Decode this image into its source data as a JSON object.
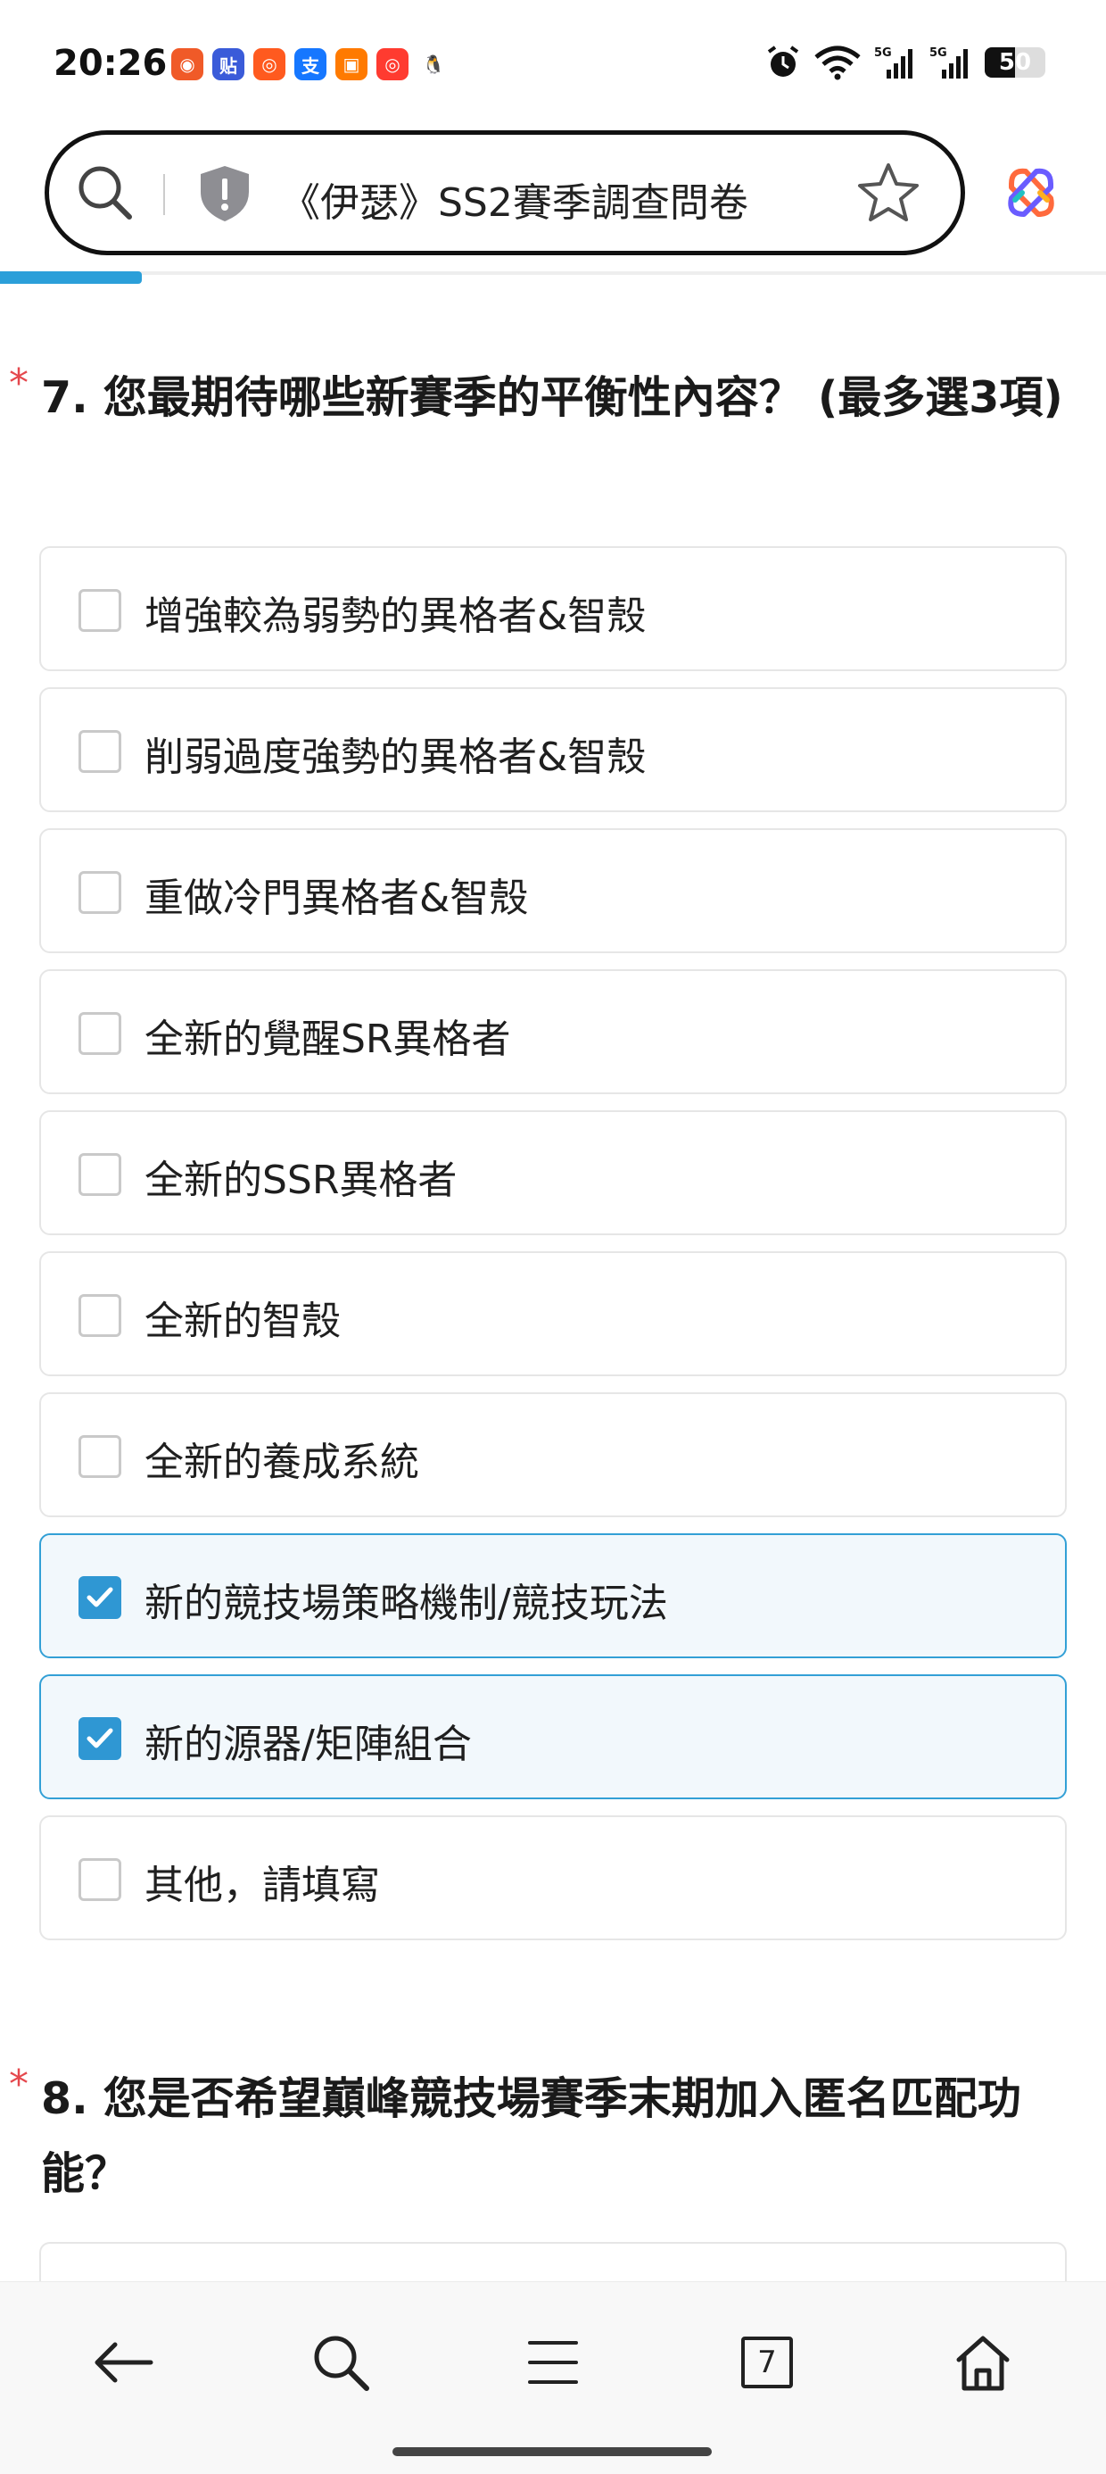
{
  "status_bar": {
    "time": "20:26",
    "battery": "50",
    "notification_icons": [
      {
        "name": "app-a-icon",
        "color": "#f05a28",
        "glyph": "◉"
      },
      {
        "name": "tieba-icon",
        "color": "#3a5bd9",
        "glyph": "贴"
      },
      {
        "name": "app-b-icon",
        "color": "#ff5a1f",
        "glyph": "◎"
      },
      {
        "name": "alipay-icon",
        "color": "#1677ff",
        "glyph": "支"
      },
      {
        "name": "wallet-icon",
        "color": "#ff7a00",
        "glyph": "▣"
      },
      {
        "name": "app-c-icon",
        "color": "#ff3b30",
        "glyph": "◎"
      },
      {
        "name": "qq-icon",
        "color": "#111111",
        "glyph": "🐧"
      }
    ],
    "system_icons": [
      "alarm-icon",
      "wifi-icon",
      "signal-5g-icon",
      "signal-5g-icon"
    ]
  },
  "address_bar": {
    "title": "《伊瑟》SS2賽季調查問卷",
    "progress_percent": 12.8
  },
  "questions": [
    {
      "number_title": "7. 您最期待哪些新賽季的平衡性內容？ (最多選3項)",
      "required_mark": "*",
      "options": [
        {
          "label": "增強較為弱勢的異格者&智殼",
          "checked": false
        },
        {
          "label": "削弱過度強勢的異格者&智殼",
          "checked": false
        },
        {
          "label": "重做冷門異格者&智殼",
          "checked": false
        },
        {
          "label": "全新的覺醒SR異格者",
          "checked": false
        },
        {
          "label": "全新的SSR異格者",
          "checked": false
        },
        {
          "label": "全新的智殼",
          "checked": false
        },
        {
          "label": "全新的養成系統",
          "checked": false
        },
        {
          "label": "新的競技場策略機制/競技玩法",
          "checked": true
        },
        {
          "label": "新的源器/矩陣組合",
          "checked": true
        },
        {
          "label": "其他，請填寫",
          "checked": false
        }
      ]
    },
    {
      "number_title": "8. 您是否希望巔峰競技場賽季末期加入匿名匹配功能？",
      "required_mark": "*"
    }
  ],
  "bottom_nav": {
    "tab_count": "7",
    "items": [
      "back-arrow-icon",
      "search-icon",
      "menu-icon",
      "tabs-icon",
      "home-icon"
    ]
  },
  "colors": {
    "accent": "#2f97d3",
    "required": "#e5484d",
    "checked_bg": "#f2f8fc"
  }
}
